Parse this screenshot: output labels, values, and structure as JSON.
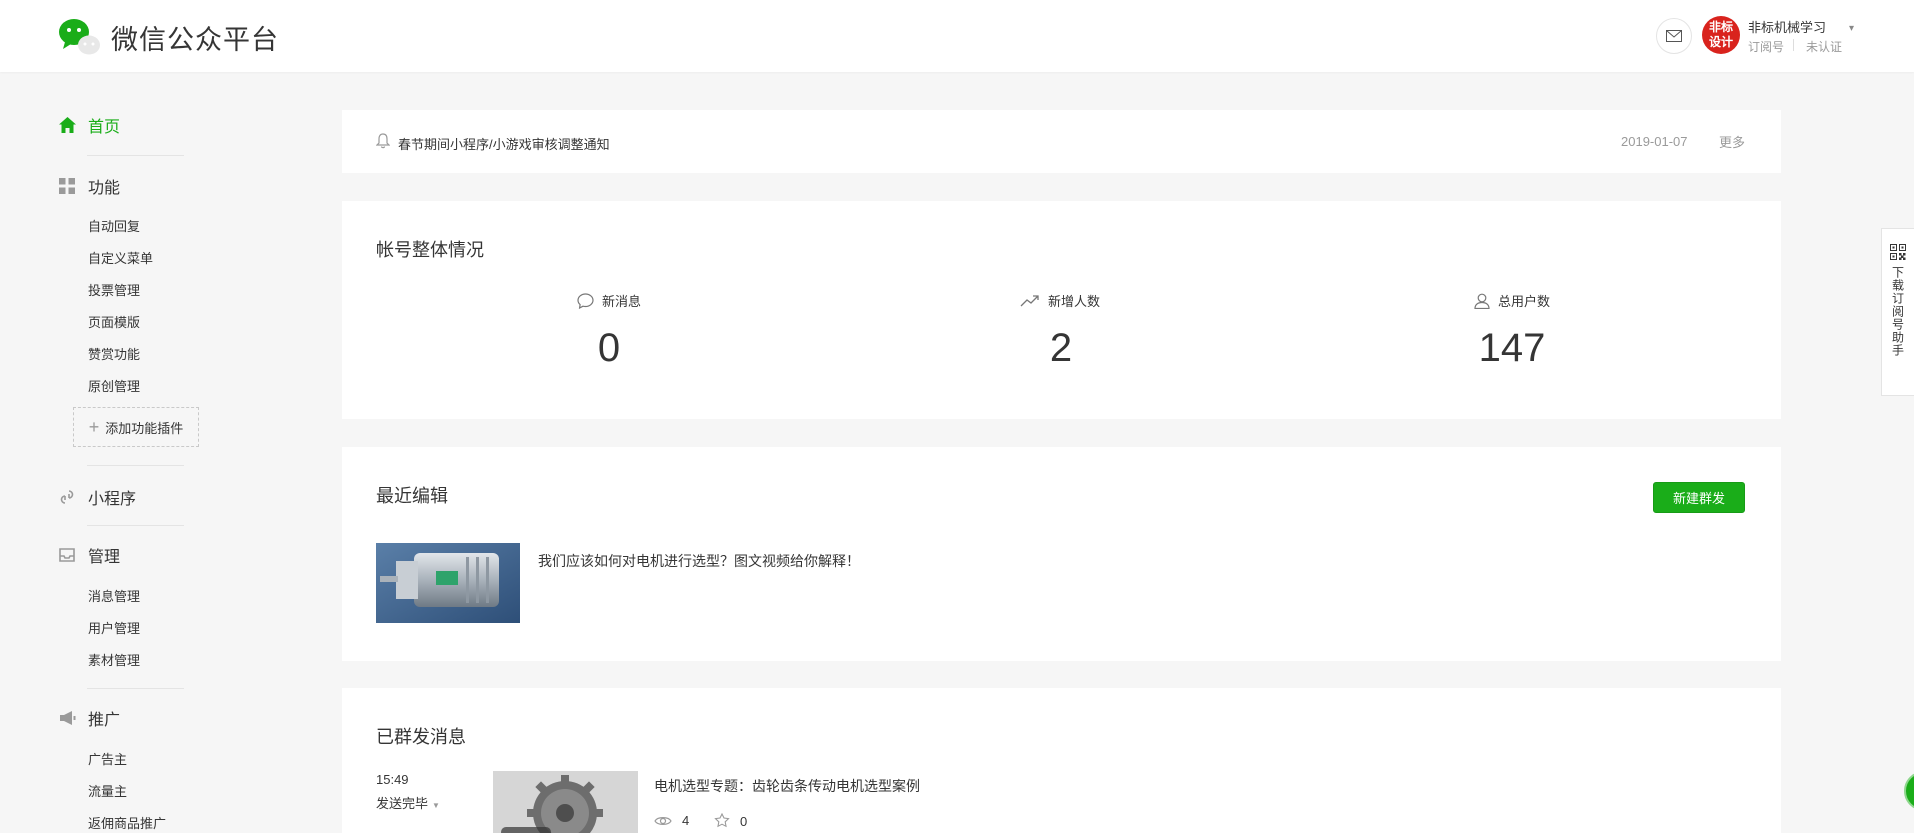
{
  "header": {
    "logo_text": "微信公众平台",
    "account": {
      "avatar_text": "非标\n设计",
      "name": "非标机械学习",
      "type": "订阅号",
      "verify": "未认证"
    }
  },
  "sidebar": {
    "home": "首页",
    "function": {
      "label": "功能",
      "items": [
        "自动回复",
        "自定义菜单",
        "投票管理",
        "页面模版",
        "赞赏功能",
        "原创管理"
      ],
      "add_plugin": "添加功能插件"
    },
    "miniprogram": "小程序",
    "manage": {
      "label": "管理",
      "items": [
        "消息管理",
        "用户管理",
        "素材管理"
      ]
    },
    "promote": {
      "label": "推广",
      "items": [
        "广告主",
        "流量主",
        "返佣商品推广"
      ]
    }
  },
  "notice": {
    "title": "春节期间小程序/小游戏审核调整通知",
    "date": "2019-01-07",
    "more": "更多"
  },
  "overview": {
    "title": "帐号整体情况",
    "stats": [
      {
        "label": "新消息",
        "value": "0",
        "icon": "message-bubble-icon"
      },
      {
        "label": "新增人数",
        "value": "2",
        "icon": "trend-up-icon"
      },
      {
        "label": "总用户数",
        "value": "147",
        "icon": "user-icon"
      }
    ]
  },
  "recent": {
    "title": "最近编辑",
    "new_button": "新建群发",
    "article_title": "我们应该如何对电机进行选型？图文视频给你解释！"
  },
  "sent": {
    "title": "已群发消息",
    "time": "15:49",
    "status": "发送完毕",
    "article_title": "电机选型专题：齿轮齿条传动电机选型案例",
    "views": "4",
    "likes": "0"
  },
  "float": {
    "download_label": "下载订阅号助手"
  },
  "colors": {
    "accent": "#1aad19",
    "background": "#f6f6f6",
    "avatar": "#d9231d"
  }
}
